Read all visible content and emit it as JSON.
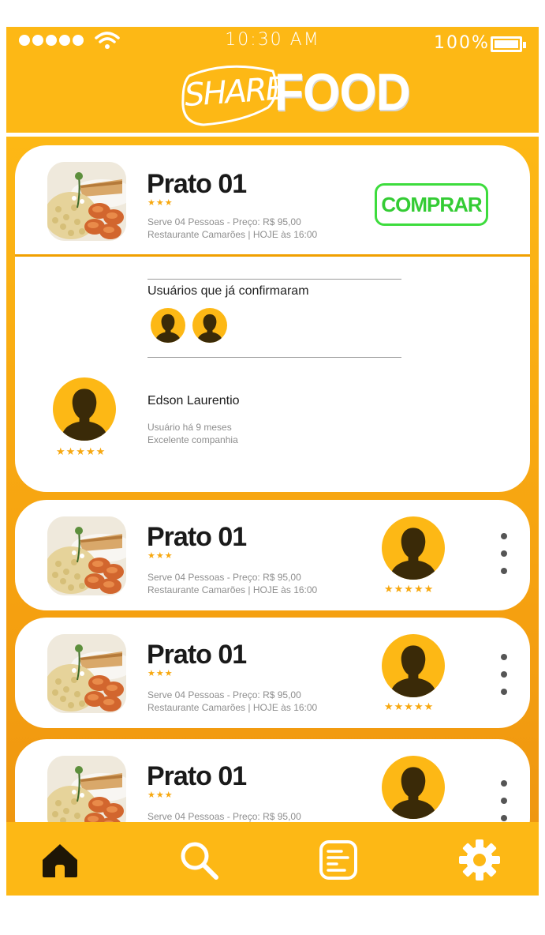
{
  "status": {
    "time": "10:30 AM",
    "battery": "100%",
    "signal_icon": "signal-dots-icon",
    "wifi_icon": "wifi-icon",
    "battery_icon": "battery-icon"
  },
  "brand": {
    "logo_share": "SHARE",
    "logo_food": "FOOD"
  },
  "colors": {
    "primary": "#fdb815",
    "accent_green": "#3ddc3d",
    "star": "#f7a810",
    "silhouette": "#3a2a08"
  },
  "expanded_card": {
    "title": "Prato 01",
    "stars": "★★★",
    "line1": "Serve 04 Pessoas - Preço: R$ 95,00",
    "line2": "Restaurante Camarões | HOJE às 16:00",
    "buy_label": "COMPRAR",
    "confirmed_label": "Usuários que já confirmaram",
    "host": {
      "name": "Edson Laurentio",
      "since": "Usuário há 9 meses",
      "review": "Excelente companhia",
      "stars": "★★★★★"
    }
  },
  "cards": [
    {
      "title": "Prato 01",
      "stars": "★★★",
      "line1": "Serve 04 Pessoas - Preço: R$ 95,00",
      "line2": "Restaurante Camarões | HOJE às 16:00",
      "host_stars": "★★★★★"
    },
    {
      "title": "Prato 01",
      "stars": "★★★",
      "line1": "Serve 04 Pessoas - Preço: R$ 95,00",
      "line2": "Restaurante Camarões | HOJE às 16:00",
      "host_stars": "★★★★★"
    },
    {
      "title": "Prato 01",
      "stars": "★★★",
      "line1": "Serve 04 Pessoas - Preço: R$ 95,00"
    }
  ],
  "tabbar": {
    "items": [
      "home-icon",
      "search-icon",
      "list-icon",
      "settings-icon"
    ],
    "active": "home-icon"
  }
}
